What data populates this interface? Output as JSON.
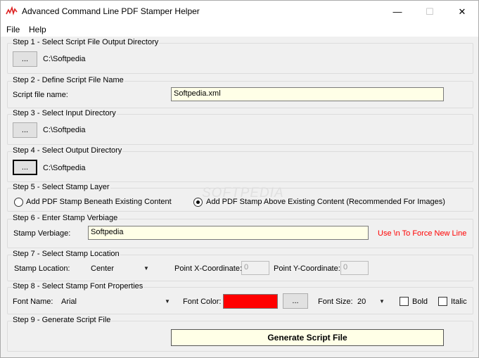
{
  "window": {
    "title": "Advanced Command Line PDF Stamper Helper",
    "min_glyph": "—",
    "max_glyph": "☐",
    "close_glyph": "✕"
  },
  "menu": {
    "file": "File",
    "help": "Help"
  },
  "watermark": "SOFTPEDIA",
  "step1": {
    "legend": "Step 1 - Select Script File Output Directory",
    "browse": "...",
    "path": "C:\\Softpedia"
  },
  "step2": {
    "legend": "Step 2 - Define Script File Name",
    "label": "Script file name:",
    "value": "Softpedia.xml"
  },
  "step3": {
    "legend": "Step 3 - Select Input Directory",
    "browse": "...",
    "path": "C:\\Softpedia"
  },
  "step4": {
    "legend": "Step 4 - Select Output Directory",
    "browse": "...",
    "path": "C:\\Softpedia"
  },
  "step5": {
    "legend": "Step 5 - Select Stamp Layer",
    "option_beneath": "Add PDF Stamp Beneath Existing Content",
    "option_above": "Add PDF Stamp Above Existing Content (Recommended For Images)",
    "selected": "above"
  },
  "step6": {
    "legend": "Step 6 - Enter Stamp Verbiage",
    "label": "Stamp Verbiage:",
    "value": "Softpedia",
    "hint": "Use \\n To Force New Line"
  },
  "step7": {
    "legend": "Step 7 - Select Stamp Location",
    "location_label": "Stamp Location:",
    "location_value": "Center",
    "x_label": "Point X-Coordinate:",
    "x_value": "0",
    "y_label": "Point Y-Coordinate:",
    "y_value": "0"
  },
  "step8": {
    "legend": "Step 8 - Select Stamp Font Properties",
    "font_label": "Font Name:",
    "font_value": "Arial",
    "color_label": "Font Color:",
    "color_value": "#ff0000",
    "color_browse": "...",
    "size_label": "Font Size:",
    "size_value": "20",
    "bold_label": "Bold",
    "italic_label": "Italic"
  },
  "step9": {
    "legend": "Step 9 - Generate Script File",
    "button": "Generate Script File"
  }
}
